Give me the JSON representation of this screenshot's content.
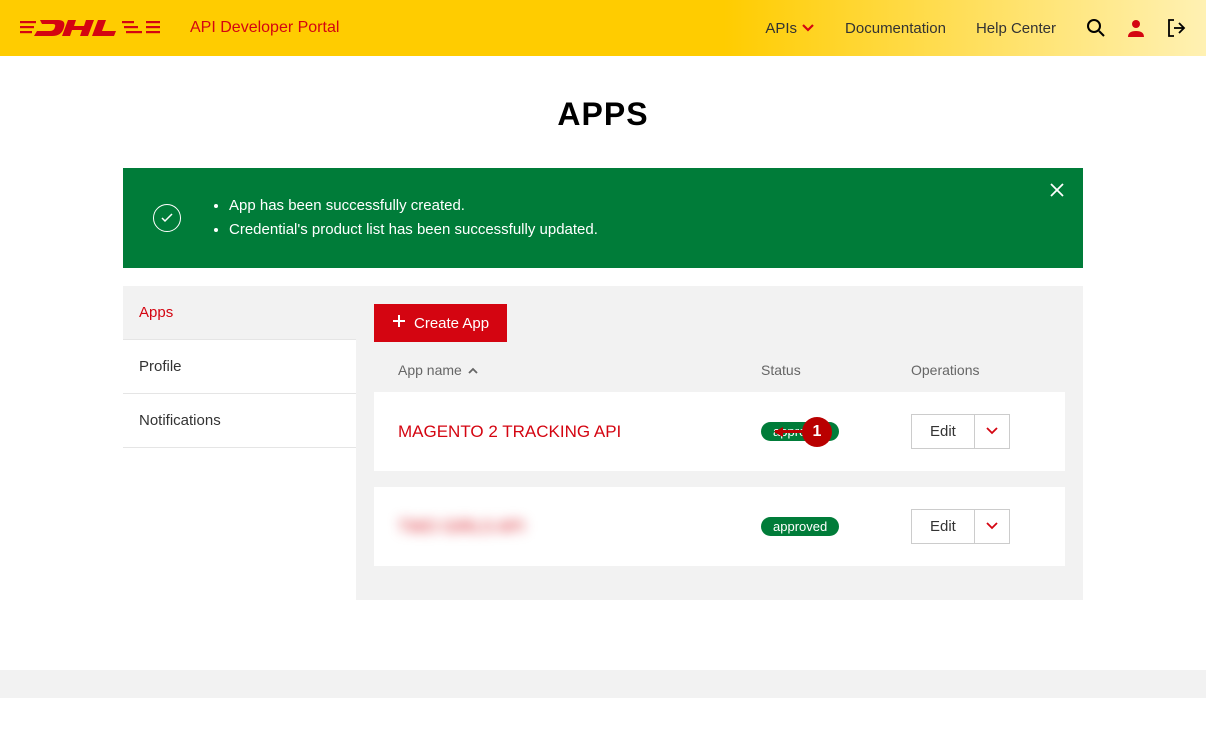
{
  "header": {
    "portal_title": "API Developer Portal",
    "nav": {
      "apis": "APIs",
      "documentation": "Documentation",
      "help_center": "Help Center"
    }
  },
  "page": {
    "title": "APPS"
  },
  "alert": {
    "messages": [
      "App has been successfully created.",
      "Credential's product list has been successfully updated."
    ]
  },
  "sidebar": {
    "apps": "Apps",
    "profile": "Profile",
    "notifications": "Notifications"
  },
  "content": {
    "create_app": "Create App",
    "columns": {
      "app_name": "App name",
      "status": "Status",
      "operations": "Operations"
    },
    "rows": [
      {
        "name": "MAGENTO 2 TRACKING API",
        "status": "approved",
        "edit": "Edit"
      },
      {
        "name": "TWO GIRLS API",
        "status": "approved",
        "edit": "Edit"
      }
    ]
  },
  "annotation": {
    "number": "1"
  }
}
